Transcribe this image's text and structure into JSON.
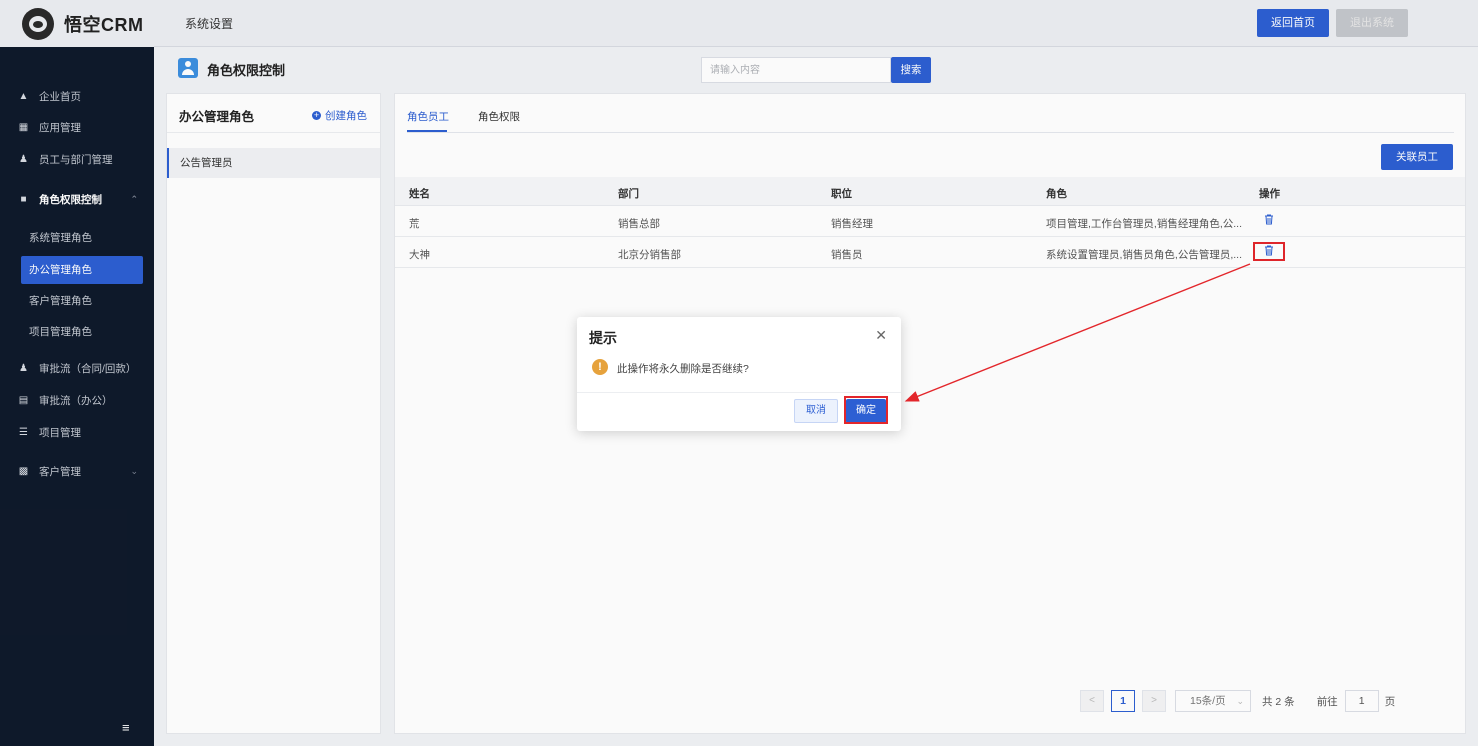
{
  "brand": {
    "name": "悟空CRM"
  },
  "header": {
    "title": "系统设置",
    "home_button": "返回首页",
    "exit_button": "退出系统"
  },
  "sidebar": {
    "items": [
      {
        "label": "企业首页",
        "icon": "home-icon"
      },
      {
        "label": "应用管理",
        "icon": "apps-icon"
      },
      {
        "label": "员工与部门管理",
        "icon": "users-icon"
      },
      {
        "label": "角色权限控制",
        "icon": "role-icon"
      },
      {
        "label": "审批流（合同/回款）",
        "icon": "person-icon"
      },
      {
        "label": "审批流（办公）",
        "icon": "monitor-icon"
      },
      {
        "label": "项目管理",
        "icon": "project-icon"
      },
      {
        "label": "客户管理",
        "icon": "customer-icon"
      }
    ],
    "sub_items": [
      "系统管理角色",
      "办公管理角色",
      "客户管理角色",
      "项目管理角色"
    ],
    "active_sub": "办公管理角色"
  },
  "subheader": {
    "title": "角色权限控制",
    "search_placeholder": "请输入内容",
    "search_button": "搜索"
  },
  "left_panel": {
    "title": "办公管理角色",
    "create_label": "创建角色",
    "roles": [
      "公告管理员"
    ]
  },
  "main": {
    "tabs": [
      "角色员工",
      "角色权限"
    ],
    "active_tab": "角色员工",
    "link_button": "关联员工",
    "columns": [
      "姓名",
      "部门",
      "职位",
      "角色",
      "操作"
    ],
    "rows": [
      {
        "name": "荒",
        "dept": "销售总部",
        "position": "销售经理",
        "roles": "项目管理,工作台管理员,销售经理角色,公..."
      },
      {
        "name": "大神",
        "dept": "北京分销售部",
        "position": "销售员",
        "roles": "系统设置管理员,销售员角色,公告管理员,..."
      }
    ]
  },
  "pagination": {
    "prev": "<",
    "current": "1",
    "next": ">",
    "page_size": "15条/页",
    "total": "共 2 条",
    "goto_label": "前往",
    "goto_value": "1",
    "page_unit": "页"
  },
  "dialog": {
    "title": "提示",
    "message": "此操作将永久删除是否继续?",
    "cancel": "取消",
    "confirm": "确定"
  },
  "colors": {
    "primary": "#2d5fd3",
    "sidebar_bg": "#0f1a2b",
    "highlight": "#e3262b",
    "warning": "#e6a23c"
  }
}
